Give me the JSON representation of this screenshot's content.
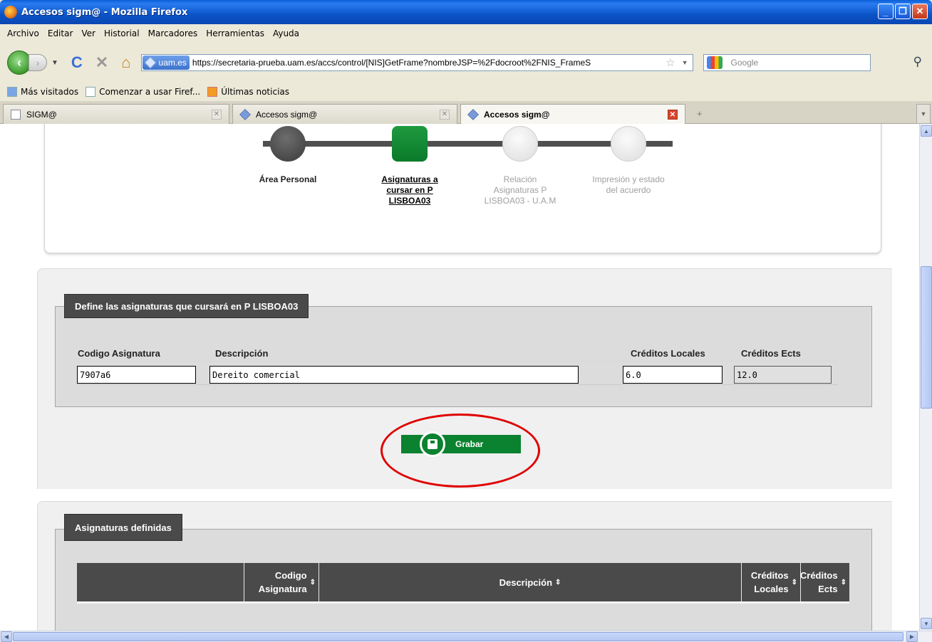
{
  "window": {
    "title": "Accesos sigm@ - Mozilla Firefox",
    "minimize": "_",
    "maximize": "❐",
    "close": "✕"
  },
  "menu": [
    "Archivo",
    "Editar",
    "Ver",
    "Historial",
    "Marcadores",
    "Herramientas",
    "Ayuda"
  ],
  "nav": {
    "site_badge": "uam.es",
    "url": "https://secretaria-prueba.uam.es/accs/control/[NIS]GetFrame?nombreJSP=%2Fdocroot%2FNIS_FrameS",
    "search_placeholder": "Google"
  },
  "bookmarks": [
    "Más visitados",
    "Comenzar a usar Firef...",
    "Últimas noticias"
  ],
  "tabs": [
    {
      "label": "SIGM@",
      "active": false
    },
    {
      "label": "Accesos sigm@",
      "active": false
    },
    {
      "label": "Accesos sigm@",
      "active": true
    }
  ],
  "steps": [
    {
      "label": "Área Personal",
      "state": "done"
    },
    {
      "label": "Asignaturas a cursar en P LISBOA03",
      "state": "current"
    },
    {
      "label": "Relación Asignaturas P LISBOA03 - U.A.M",
      "state": "todo"
    },
    {
      "label": "Impresión y estado del acuerdo",
      "state": "todo"
    }
  ],
  "form": {
    "legend": "Define las asignaturas que cursará en P LISBOA03",
    "headers": {
      "code": "Codigo Asignatura",
      "description": "Descripción",
      "local_credits": "Créditos Locales",
      "ects_credits": "Créditos Ects"
    },
    "values": {
      "code": "7907a6",
      "description": "Dereito comercial",
      "local_credits": "6.0",
      "ects_credits": "12.0"
    },
    "save_label": "Grabar"
  },
  "list": {
    "legend": "Asignaturas definidas",
    "columns": [
      {
        "label": "",
        "sortable": false
      },
      {
        "label": "Codigo Asignatura",
        "sortable": true
      },
      {
        "label": "Descripción",
        "sortable": true
      },
      {
        "label": "Créditos Locales",
        "sortable": true
      },
      {
        "label": "Créditos Ects",
        "sortable": true
      }
    ]
  },
  "colors": {
    "accent_green": "#0b8230",
    "header_dark": "#4a4a4a",
    "highlight_ring": "#e00000"
  }
}
